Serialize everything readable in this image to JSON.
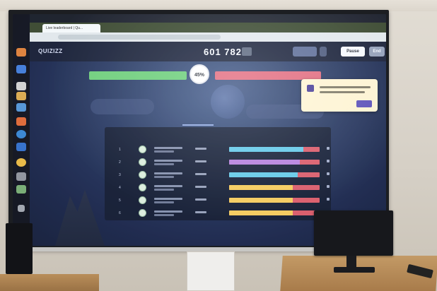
{
  "browser": {
    "tab_title": "Live leaderboard | Qu..."
  },
  "quiz": {
    "logo": "QUIZIZZ",
    "score": "601 782",
    "percent": "45%",
    "buttons": {
      "pause": "Pause",
      "end": "End"
    }
  },
  "leaderboard": {
    "rows": [
      {
        "rank": "1",
        "accuracy": 0.82,
        "bar_color": "#55c3e6"
      },
      {
        "rank": "2",
        "accuracy": 0.78,
        "bar_color": "#b47be0"
      },
      {
        "rank": "3",
        "accuracy": 0.76,
        "bar_color": "#55c3e6"
      },
      {
        "rank": "4",
        "accuracy": 0.7,
        "bar_color": "#f0c24a"
      },
      {
        "rank": "5",
        "accuracy": 0.7,
        "bar_color": "#f0c24a"
      },
      {
        "rank": "6",
        "accuracy": 0.7,
        "bar_color": "#f0c24a"
      }
    ]
  },
  "colors": {
    "correct": "#5fc96e",
    "incorrect": "#e5657a",
    "popup": "#f2e7c4"
  }
}
